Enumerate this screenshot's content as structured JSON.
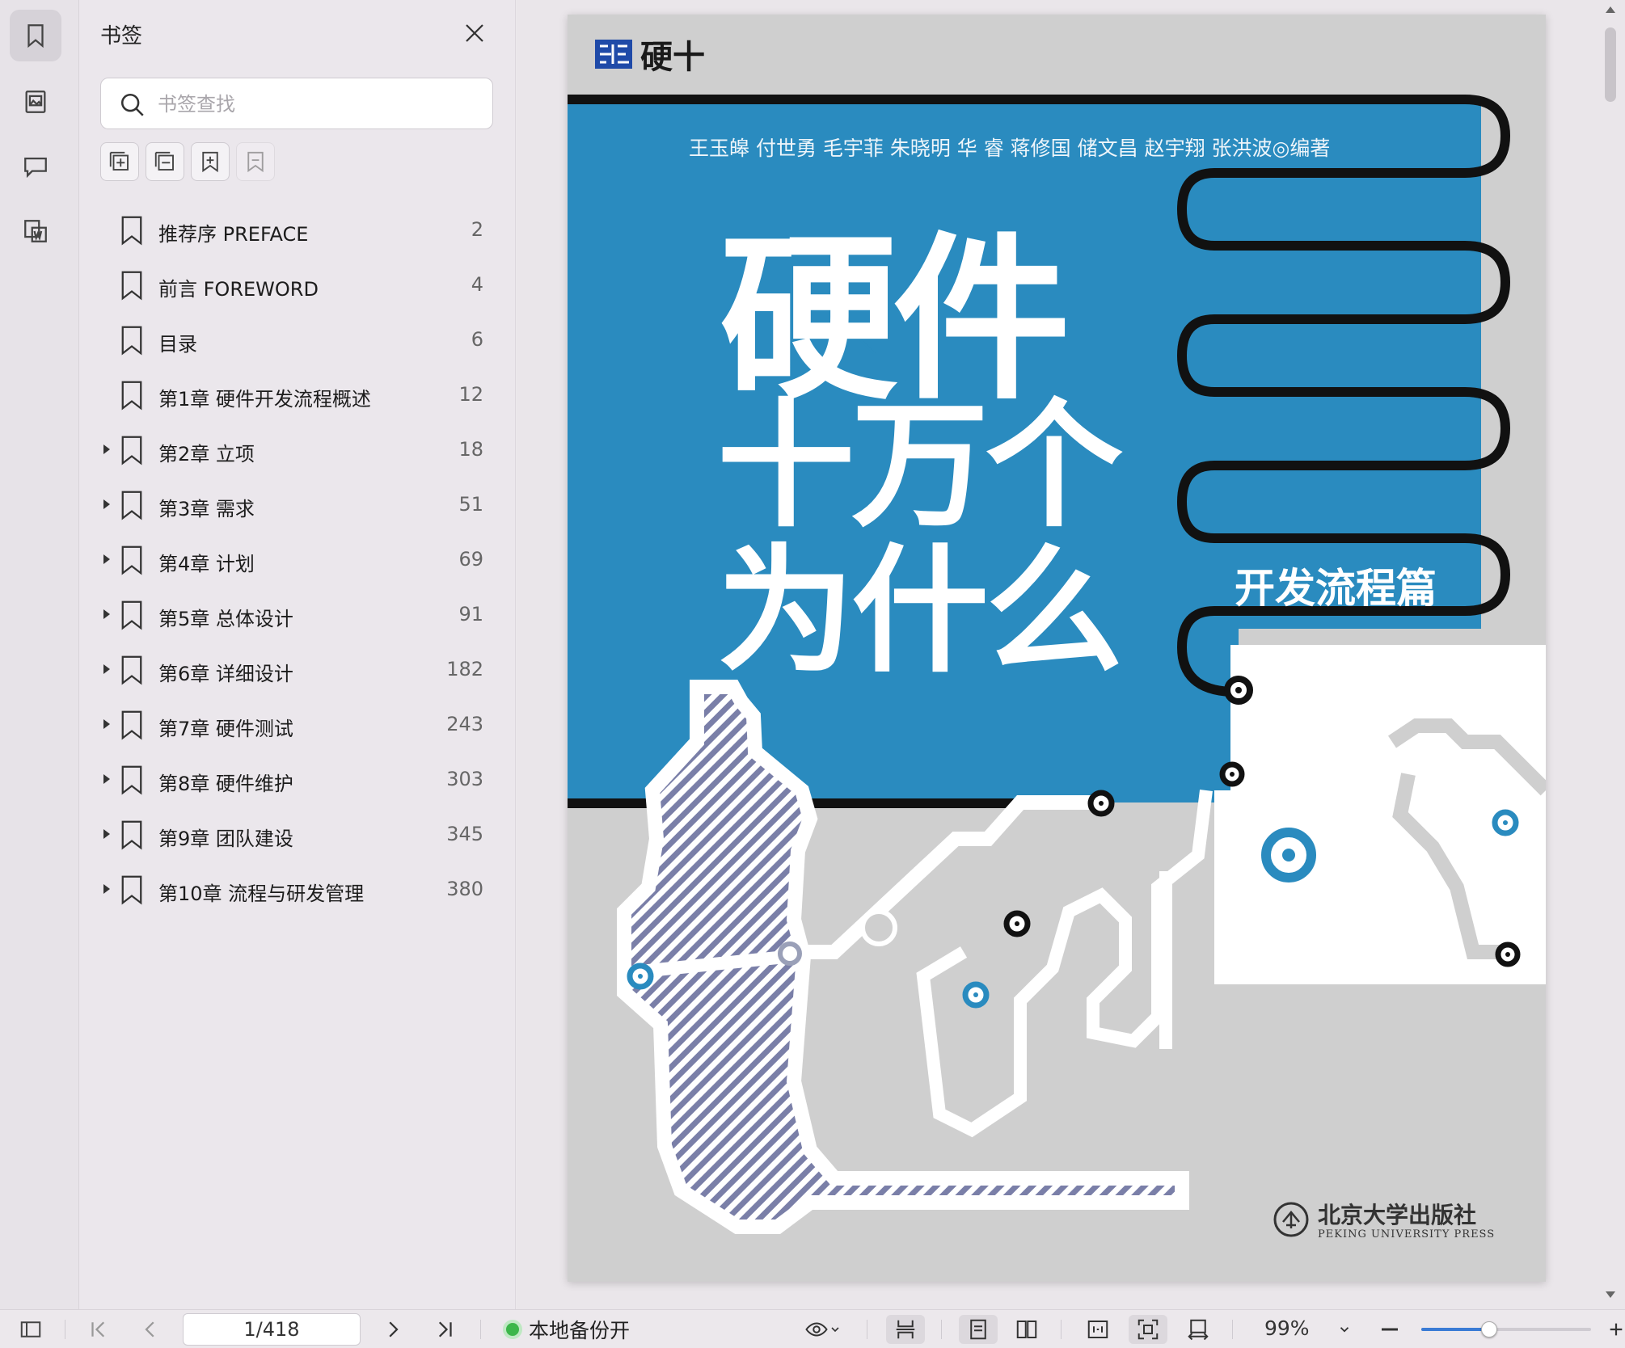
{
  "panel": {
    "title": "书签",
    "search_placeholder": "书签查找"
  },
  "bookmarks": [
    {
      "label": "推荐序 PREFACE",
      "page": "2",
      "expandable": false
    },
    {
      "label": "前言 FOREWORD",
      "page": "4",
      "expandable": false
    },
    {
      "label": "目录",
      "page": "6",
      "expandable": false
    },
    {
      "label": "第1章  硬件开发流程概述",
      "page": "12",
      "expandable": false
    },
    {
      "label": "第2章  立项",
      "page": "18",
      "expandable": true
    },
    {
      "label": "第3章  需求",
      "page": "51",
      "expandable": true
    },
    {
      "label": "第4章  计划",
      "page": "69",
      "expandable": true
    },
    {
      "label": "第5章  总体设计",
      "page": "91",
      "expandable": true
    },
    {
      "label": "第6章  详细设计",
      "page": "182",
      "expandable": true
    },
    {
      "label": "第7章  硬件测试",
      "page": "243",
      "expandable": true
    },
    {
      "label": "第8章  硬件维护",
      "page": "303",
      "expandable": true
    },
    {
      "label": "第9章  团队建设",
      "page": "345",
      "expandable": true
    },
    {
      "label": "第10章  流程与研发管理",
      "page": "380",
      "expandable": true
    }
  ],
  "cover": {
    "series": "硬十",
    "authors": "王玉皞 付世勇 毛宇菲 朱晓明 华    睿 蒋修国 储文昌 赵宇翔 张洪波◎编著",
    "title_line1": "硬件",
    "title_line2": "十万个",
    "title_line3": "为什么",
    "subtitle": "开发流程篇",
    "publisher_cn": "北京大学出版社",
    "publisher_en": "PEKING UNIVERSITY PRESS",
    "colors": {
      "blue": "#2a8bbf",
      "gray": "#cfcfcf",
      "stripe": "#7a7fa8"
    }
  },
  "bottombar": {
    "page_indicator": "1/418",
    "backup_status": "本地备份开",
    "zoom": "99%",
    "zoom_fraction": 0.4
  },
  "colors": {
    "accent": "#3a7bd5",
    "status_green": "#3cb64a"
  }
}
